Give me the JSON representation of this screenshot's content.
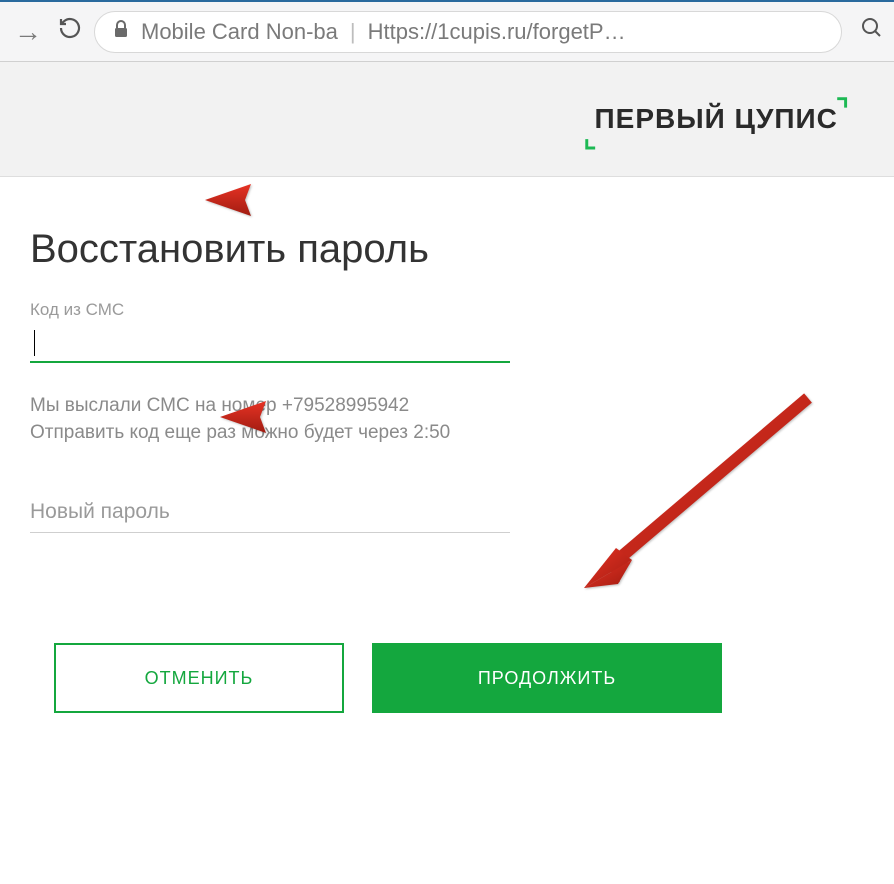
{
  "browser": {
    "page_title": "Mobile Card Non-ba",
    "url": "Https://1cupis.ru/forgetP…"
  },
  "logo": {
    "text": "ПЕРВЫЙ ЦУПИС"
  },
  "form": {
    "heading": "Восстановить пароль",
    "sms_label": "Код из СМС",
    "sms_value": "",
    "info_line1": "Мы выслали СМС на номер +79528995942",
    "info_line2": "Отправить код еще раз можно будет через 2:50",
    "new_password_placeholder": "Новый пароль",
    "new_password_value": ""
  },
  "buttons": {
    "cancel": "ОТМЕНИТЬ",
    "continue": "ПРОДОЛЖИТЬ"
  }
}
